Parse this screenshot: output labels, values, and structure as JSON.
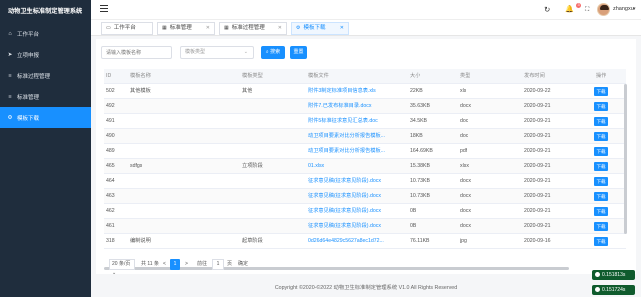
{
  "app": {
    "title": "动物卫生标准制定管理系统"
  },
  "sidebar": {
    "items": [
      {
        "icon": "home-icon",
        "glyph": "⌂",
        "label": "工作平台"
      },
      {
        "icon": "send-icon",
        "glyph": "➤",
        "label": "立项申报"
      },
      {
        "icon": "list-icon",
        "glyph": "≡",
        "label": "标准过程管理"
      },
      {
        "icon": "list-icon",
        "glyph": "≡",
        "label": "标准管理"
      },
      {
        "icon": "settings-icon",
        "glyph": "⚙",
        "label": "模板下载",
        "active": true
      }
    ]
  },
  "header": {
    "username": "zhangxu",
    "badge": "3"
  },
  "tabs": [
    {
      "icon": "monitor-icon",
      "glyph": "▭",
      "label": "工作平台"
    },
    {
      "icon": "table-icon",
      "glyph": "▦",
      "label": "标准管理"
    },
    {
      "icon": "table-icon",
      "glyph": "▦",
      "label": "标准过程管理"
    },
    {
      "icon": "gear-icon",
      "glyph": "⚙",
      "label": "模板下载",
      "active": true
    }
  ],
  "search": {
    "placeholder": "请输入模板名称",
    "type_placeholder": "模板类型",
    "search_label": "搜索",
    "reset_label": "重置"
  },
  "table": {
    "headers": [
      "ID",
      "模板名称",
      "模板类型",
      "模板文件",
      "大小",
      "类型",
      "发布时间",
      "操作"
    ],
    "action_label": "下载",
    "rows": [
      [
        "502",
        "其他模板",
        "其他",
        "附件3制定标准项目信息表.xls",
        "22KB",
        "xls",
        "2020-09-22"
      ],
      [
        "492",
        "",
        "",
        "附件7.已发布标准目录.docx",
        "35.63KB",
        "docx",
        "2020-09-21"
      ],
      [
        "491",
        "",
        "",
        "附件5标准征求意见汇总表.doc",
        "34.5KB",
        "doc",
        "2020-09-21"
      ],
      [
        "490",
        "",
        "",
        "动卫项目要素对比分析报告模板...",
        "18KB",
        "doc",
        "2020-09-21"
      ],
      [
        "489",
        "",
        "",
        "动卫项目要素对比分析报告模板...",
        "164.69KB",
        "pdf",
        "2020-09-21"
      ],
      [
        "465",
        "sdfgs",
        "立项阶段",
        "01.xlsx",
        "15.38KB",
        "xlsx",
        "2020-09-21"
      ],
      [
        "464",
        "",
        "",
        "征求意见稿(征求意见阶段).docx",
        "10.73KB",
        "docx",
        "2020-09-21"
      ],
      [
        "463",
        "",
        "",
        "征求意见稿(征求意见阶段).docx",
        "10.73KB",
        "docx",
        "2020-09-21"
      ],
      [
        "462",
        "",
        "",
        "征求意见稿(征求意见阶段).docx",
        "0B",
        "docx",
        "2020-09-21"
      ],
      [
        "461",
        "",
        "",
        "征求意见稿(征求意见阶段).docx",
        "0B",
        "docx",
        "2020-09-21"
      ],
      [
        "318",
        "编制说明",
        "起草阶段",
        "0d26d64e4829c5627a8ec1d72...",
        "76.11KB",
        "jpg",
        "2020-09-16"
      ]
    ]
  },
  "pagination": {
    "page_size": "20 条/页",
    "total": "共 11 条",
    "prev": "<",
    "current": "1",
    "next": ">",
    "goto_label": "前往",
    "goto_value": "1",
    "page_suffix": "页",
    "confirm_label": "确定"
  },
  "footer": {
    "text": "Copyright ©2020-©2022 动物卫生标准制定管理系统 V1.0 All Rights Reserved"
  },
  "perf": [
    "0.151813s",
    "0.151724s"
  ]
}
